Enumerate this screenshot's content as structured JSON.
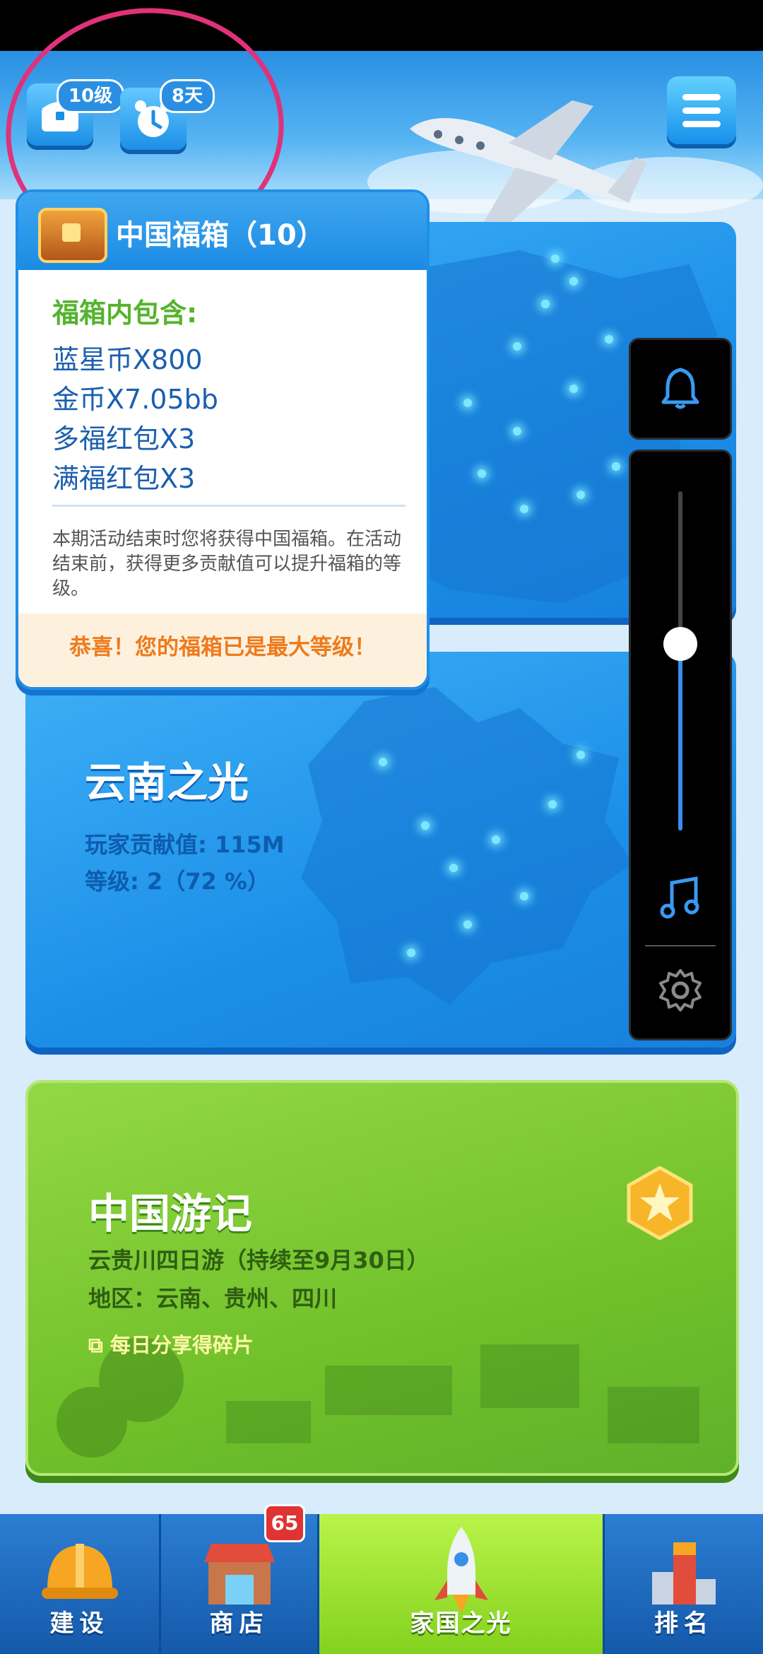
{
  "top": {
    "level_badge": "10级",
    "days_badge": "8天"
  },
  "popup": {
    "title": "中国福箱（10）",
    "subtitle": "福箱内包含:",
    "items": [
      "蓝星币X800",
      "金币X7.05bb",
      "多福红包X3",
      "满福红包X3"
    ],
    "desc": "本期活动结束时您将获得中国福箱。在活动结束前，获得更多贡献值可以提升福箱的等级。",
    "footer": "恭喜！您的福箱已是最大等级！"
  },
  "yunnan": {
    "title": "云南之光",
    "contribution": "玩家贡献值: 115M",
    "level": "等级: 2（72 %）"
  },
  "journey": {
    "title": "中国游记",
    "trip": "云贵川四日游（持续至9月30日）",
    "region": "地区：云南、贵州、四川",
    "share": "每日分享得碎片"
  },
  "side_panel": {
    "volume_level": 0.55,
    "icons": [
      "bell-icon",
      "music-note-icon",
      "gear-icon"
    ]
  },
  "nav": {
    "build": "建设",
    "shop": "商店",
    "shop_badge": "65",
    "home": "家国之光",
    "rank": "排名"
  },
  "colors": {
    "accent_blue": "#1b8fe8",
    "accent_green": "#71c12a",
    "annotation_pink": "#e0327a",
    "popup_highlight": "#ee7a1c"
  }
}
